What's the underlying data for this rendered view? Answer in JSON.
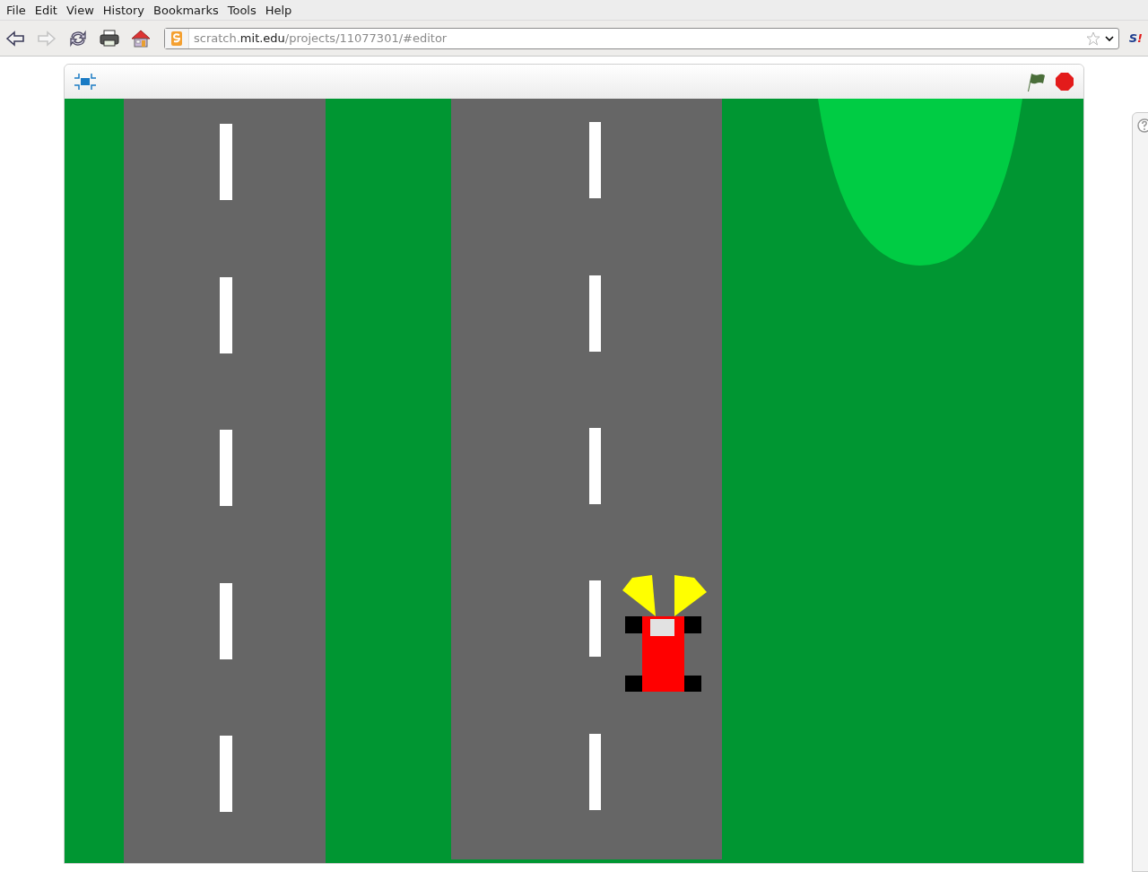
{
  "menu": [
    "File",
    "Edit",
    "View",
    "History",
    "Bookmarks",
    "Tools",
    "Help"
  ],
  "address": {
    "prefix": "scratch.",
    "domain": "mit.edu",
    "path": "/projects/11077301/#editor"
  },
  "extension_logo": "S!"
}
